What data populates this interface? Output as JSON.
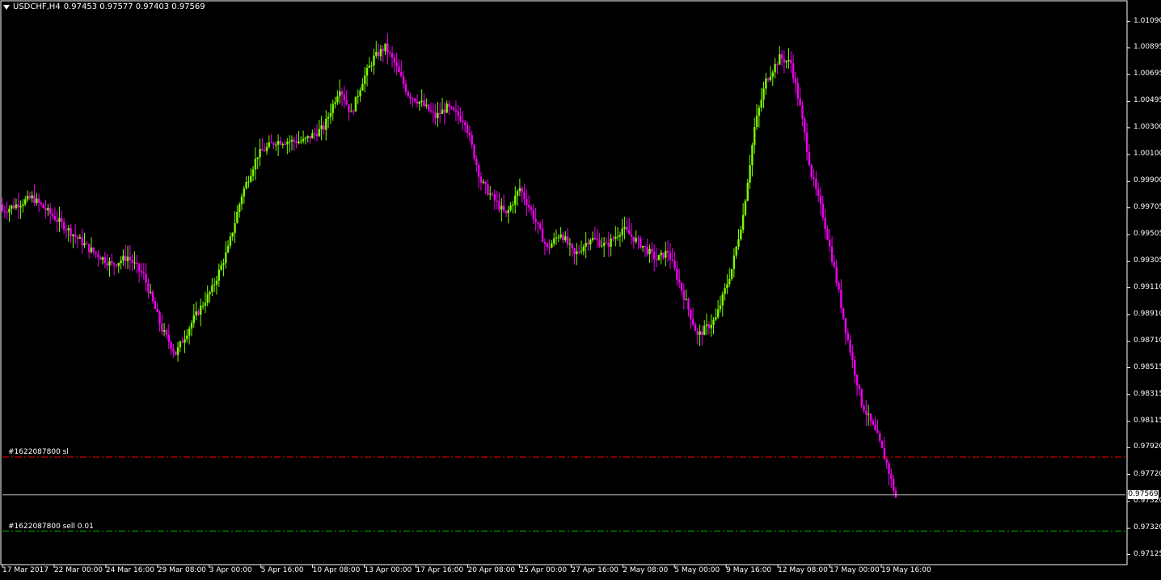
{
  "header": {
    "symbol": "USDCHF,H4",
    "ohlc": "0.97453 0.97577 0.97403 0.97569"
  },
  "colors": {
    "bull": "#7cfc00",
    "bear": "#ee00ee",
    "background": "#000000",
    "sl_line": "#ff0000",
    "entry_line": "#00c000",
    "price_line": "#c0c0c0",
    "frame": "#ffffff"
  },
  "order_lines": [
    {
      "label": "#1622087800 sl",
      "price": 0.9785
    },
    {
      "label": "#1622087800 sell 0.01",
      "price": 0.973
    }
  ],
  "current_price": {
    "label": "0.97569",
    "value": 0.97569
  },
  "chart_data": {
    "type": "candlestick",
    "title": "USDCHF,H4",
    "ylim": [
      0.9705,
      1.0125
    ],
    "y_ticks": [
      "1.01090",
      "1.00895",
      "1.00695",
      "1.00495",
      "1.00300",
      "1.00100",
      "0.99900",
      "0.99705",
      "0.99505",
      "0.99305",
      "0.99110",
      "0.98910",
      "0.98710",
      "0.98515",
      "0.98315",
      "0.98115",
      "0.97920",
      "0.97720",
      "0.97520",
      "0.97320",
      "0.97125"
    ],
    "x_ticks": [
      "17 Mar 2017",
      "22 Mar 00:00",
      "24 Mar 16:00",
      "29 Mar 08:00",
      "3 Apr 00:00",
      "5 Apr 16:00",
      "10 Apr 08:00",
      "13 Apr 00:00",
      "17 Apr 16:00",
      "20 Apr 08:00",
      "25 Apr 00:00",
      "27 Apr 16:00",
      "2 May 08:00",
      "5 May 00:00",
      "9 May 16:00",
      "12 May 08:00",
      "17 May 00:00",
      "19 May 16:00"
    ],
    "close_path": [
      [
        0,
        0.9968
      ],
      [
        13,
        0.9978
      ],
      [
        25,
        0.996
      ],
      [
        38,
        0.994
      ],
      [
        48,
        0.9928
      ],
      [
        55,
        0.9934
      ],
      [
        62,
        0.992
      ],
      [
        70,
        0.988
      ],
      [
        76,
        0.9862
      ],
      [
        84,
        0.9888
      ],
      [
        92,
        0.991
      ],
      [
        99,
        0.994
      ],
      [
        105,
        0.998
      ],
      [
        112,
        1.001
      ],
      [
        120,
        1.002
      ],
      [
        132,
        1.002
      ],
      [
        141,
        1.003
      ],
      [
        148,
        1.006
      ],
      [
        153,
        1.004
      ],
      [
        158,
        1.0065
      ],
      [
        163,
        1.0082
      ],
      [
        168,
        1.009
      ],
      [
        172,
        1.0078
      ],
      [
        178,
        1.0055
      ],
      [
        184,
        1.0048
      ],
      [
        190,
        1.0038
      ],
      [
        195,
        1.0045
      ],
      [
        203,
        1.0035
      ],
      [
        210,
        0.999
      ],
      [
        215,
        0.9978
      ],
      [
        221,
        0.9965
      ],
      [
        227,
        0.9985
      ],
      [
        232,
        0.9968
      ],
      [
        239,
        0.994
      ],
      [
        245,
        0.9952
      ],
      [
        251,
        0.9935
      ],
      [
        258,
        0.9948
      ],
      [
        265,
        0.9942
      ],
      [
        272,
        0.9955
      ],
      [
        281,
        0.9942
      ],
      [
        287,
        0.9932
      ],
      [
        292,
        0.9938
      ],
      [
        299,
        0.9905
      ],
      [
        305,
        0.9875
      ],
      [
        313,
        0.9888
      ],
      [
        320,
        0.9925
      ],
      [
        325,
        0.9965
      ],
      [
        330,
        1.003
      ],
      [
        335,
        1.0065
      ],
      [
        341,
        1.0082
      ],
      [
        346,
        1.0078
      ],
      [
        350,
        1.0045
      ],
      [
        355,
        0.9995
      ],
      [
        360,
        0.9965
      ],
      [
        365,
        0.9925
      ],
      [
        370,
        0.988
      ],
      [
        377,
        0.9825
      ],
      [
        384,
        0.98
      ],
      [
        388,
        0.978
      ],
      [
        392,
        0.9755
      ]
    ]
  }
}
